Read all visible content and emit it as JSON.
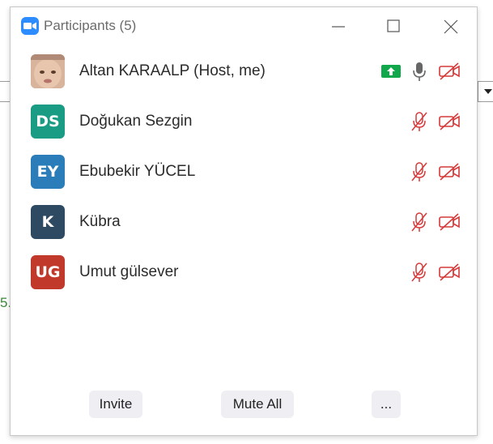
{
  "window": {
    "title": "Participants (5)"
  },
  "participants": [
    {
      "name": "Altan KARAALP (Host, me)",
      "avatar_type": "photo",
      "sharing": true,
      "mic": "on",
      "video": "off"
    },
    {
      "name": "Doğukan Sezgin",
      "initials": "DS",
      "avatar_color": "#1a9c84",
      "mic": "muted",
      "video": "off"
    },
    {
      "name": "Ebubekir YÜCEL",
      "initials": "EY",
      "avatar_color": "#2a7db8",
      "mic": "muted",
      "video": "off"
    },
    {
      "name": "Kübra",
      "initials": "K",
      "avatar_color": "#2e4a63",
      "mic": "muted",
      "video": "off"
    },
    {
      "name": "Umut gülsever",
      "initials": "UG",
      "avatar_color": "#c0392b",
      "mic": "muted",
      "video": "off"
    }
  ],
  "footer": {
    "invite_label": "Invite",
    "mute_all_label": "Mute All",
    "more_label": "..."
  },
  "colors": {
    "muted_red": "#d63a3a",
    "share_green": "#11a84b",
    "brand_blue": "#2d8cff"
  }
}
